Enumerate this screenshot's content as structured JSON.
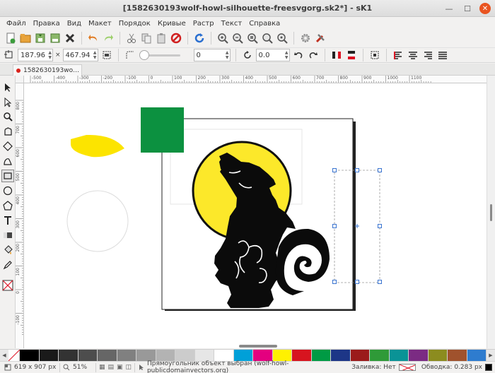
{
  "window": {
    "title": "[1582630193wolf-howl-silhouette-freesvgorg.sk2*] - sK1"
  },
  "menu": [
    "Файл",
    "Правка",
    "Вид",
    "Макет",
    "Порядок",
    "Кривые",
    "Растр",
    "Текст",
    "Справка"
  ],
  "toolbar_icons": [
    "new-document-icon",
    "open-icon",
    "save-icon",
    "save-as-icon",
    "close-document-icon",
    "undo-icon",
    "redo-icon",
    "cut-icon",
    "copy-icon",
    "paste-icon",
    "delete-icon",
    "refresh-icon",
    "zoom-in-icon",
    "zoom-out-icon",
    "zoom-page-icon",
    "zoom-selected-icon",
    "zoom-100-icon",
    "preferences-icon",
    "properties-icon"
  ],
  "propbar": {
    "x_value": "187.96",
    "w_value": "467.94",
    "radius_value": "0",
    "angle_value": "0.0"
  },
  "tab": {
    "label": "1582630193wo…"
  },
  "ruler": {
    "h_ticks": [
      "-500",
      "-400",
      "-300",
      "-200",
      "-100",
      "0",
      "100",
      "200",
      "300",
      "400",
      "500",
      "600",
      "700",
      "800",
      "900",
      "1000",
      "1100"
    ],
    "v_ticks": [
      "800",
      "700",
      "600",
      "500",
      "400",
      "300",
      "200",
      "100",
      "0",
      "-100"
    ]
  },
  "tools": [
    "select-tool-icon",
    "node-tool-icon",
    "zoom-tool-icon",
    "fleur-tool-icon",
    "bezier-tool-icon",
    "polyline-tool-icon",
    "rectangle-tool-icon",
    "ellipse-tool-icon",
    "polygon-tool-icon",
    "text-tool-icon",
    "gradient-tool-icon",
    "fill-tool-icon",
    "stroke-tool-icon",
    "no-fill-swatch-icon"
  ],
  "palette": [
    "#000000",
    "#1a1a1a",
    "#333333",
    "#4d4d4d",
    "#666666",
    "#808080",
    "#999999",
    "#b3b3b3",
    "#cccccc",
    "#e6e6e6",
    "#ffffff",
    "#00a0d8",
    "#e4007f",
    "#fff100",
    "#d7141f",
    "#009a44",
    "#1d3687",
    "#9b1b1b",
    "#2f9a38",
    "#0a9396",
    "#7b2b83",
    "#8c8c1f",
    "#a0522d",
    "#2e7ccf"
  ],
  "colors": {
    "moon": "#fce82a",
    "green_square": "#0c9140",
    "yellow_shape": "#fce400",
    "selection": "#3a74d0"
  },
  "status": {
    "size": "619 x 907 px",
    "zoom": "51%",
    "message": "Прямоугольник объект выбран (wolf-howl-publicdomainvectors.org)",
    "fill_label": "Заливка: Нет",
    "stroke_label": "Обводка: 0.283 px"
  }
}
